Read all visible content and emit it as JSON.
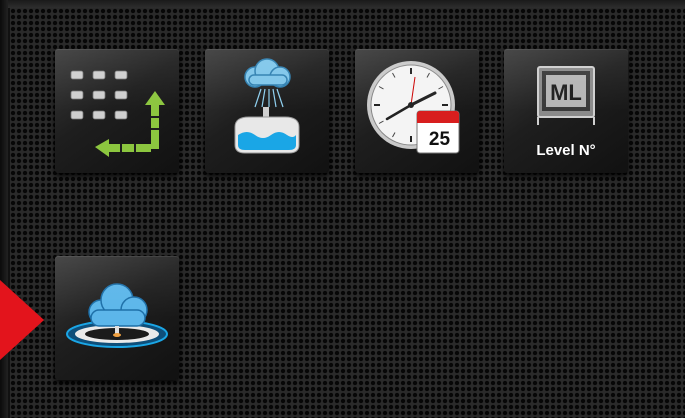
{
  "tiles": [
    {
      "name": "tray-layout",
      "icon": "tray-grid-arrows-icon",
      "label": ""
    },
    {
      "name": "washing",
      "icon": "wash-tank-icon",
      "label": ""
    },
    {
      "name": "clock-calendar",
      "icon": "clock-calendar-icon",
      "label": "",
      "calendar_day": "25"
    },
    {
      "name": "level-number",
      "icon": "level-oven-icon",
      "label": "Level N°"
    },
    {
      "name": "steam-cloud",
      "icon": "cloud-ring-icon",
      "label": ""
    }
  ],
  "colors": {
    "pointer": "#e3141c",
    "arrows": "#8cc63f",
    "water": "#1aa6e6",
    "calendar_header": "#d81e1e"
  }
}
